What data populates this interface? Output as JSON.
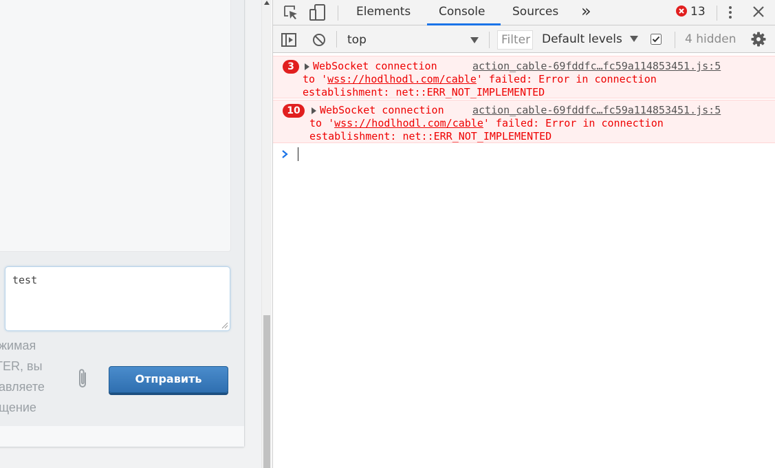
{
  "page": {
    "message_input_value": "test",
    "hint_lines": [
      "ажимая",
      "ITER, вы",
      "равляете",
      "бщение"
    ],
    "send_button_label": "Отправить"
  },
  "devtools": {
    "tabs": [
      "Elements",
      "Console",
      "Sources"
    ],
    "active_tab": "Console",
    "more_tabs_label": "»",
    "error_count": "13",
    "toolbar": {
      "context": "top",
      "filter_placeholder": "Filter",
      "levels": "Default levels",
      "hidden": "4 hidden"
    },
    "messages": [
      {
        "count": "3",
        "source": "action_cable-69fddfc…fc59a114853451.js:5",
        "line1": "WebSocket connection",
        "line2_prefix": "to '",
        "url": "wss://hodlhodl.com/cable",
        "line2_suffix": "' failed: Error in connection",
        "line3": "establishment: net::ERR_NOT_IMPLEMENTED"
      },
      {
        "count": "10",
        "source": "action_cable-69fddfc…fc59a114853451.js:5",
        "line1": "WebSocket connection",
        "line2_prefix": "to '",
        "url": "wss://hodlhodl.com/cable",
        "line2_suffix": "' failed: Error in connection",
        "line3": "establishment: net::ERR_NOT_IMPLEMENTED"
      }
    ],
    "colors": {
      "error_text": "#e00000",
      "error_bg": "#fff0f0",
      "badge": "#e11f1f",
      "accent": "#1a73e8"
    }
  }
}
